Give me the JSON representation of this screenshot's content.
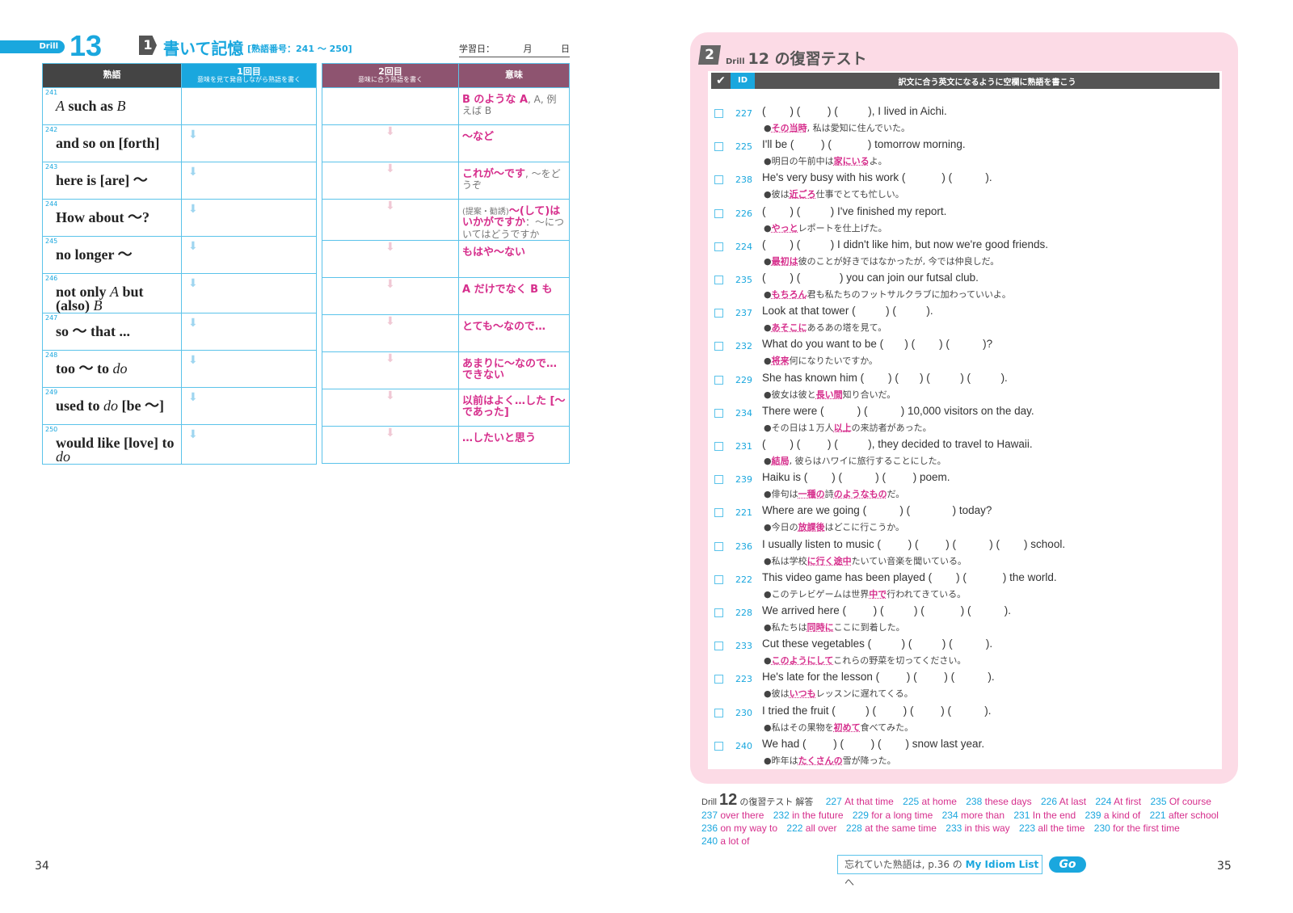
{
  "left": {
    "drill_label": "Drill",
    "drill_number": "13",
    "section_badge": "1",
    "section_title": "書いて記憶",
    "section_range": "[熟語番号：241 ～ 250]",
    "study_date": {
      "label": "学習日：",
      "month": "月",
      "day": "日"
    },
    "headers": {
      "idiom": "熟語",
      "first": "1回目",
      "first_sub": "意味を見て発音しながら熟語を書く",
      "second": "2回目",
      "second_sub": "意味に合う熟語を書く",
      "meaning": "意味"
    },
    "colors": {
      "blue": "#1aa7de",
      "purple": "#8e5470",
      "dark": "#444444",
      "pink": "#d62e8c"
    },
    "rows": [
      {
        "num": "241",
        "idiom": [
          {
            "t": "A",
            "i": true
          },
          {
            "t": " such as "
          },
          {
            "t": "B",
            "i": true
          }
        ],
        "meaning": [
          {
            "t": "B のような A",
            "em": true
          },
          {
            "t": ", A, 例えば B"
          }
        ]
      },
      {
        "num": "242",
        "idiom": [
          {
            "t": "and so on [forth]"
          }
        ],
        "meaning": [
          {
            "t": "～など",
            "em": true
          }
        ]
      },
      {
        "num": "243",
        "idiom": [
          {
            "t": "here is [are] ～"
          }
        ],
        "meaning": [
          {
            "t": "これが～です",
            "em": true
          },
          {
            "t": ", ～をどうぞ"
          }
        ]
      },
      {
        "num": "244",
        "idiom": [
          {
            "t": "How about ～?"
          }
        ],
        "meaning": [
          {
            "t": "(提案・勧誘)",
            "pre": true
          },
          {
            "t": "～(して)はいかがですか",
            "em": true
          },
          {
            "t": "：～についてはどうですか"
          }
        ]
      },
      {
        "num": "245",
        "idiom": [
          {
            "t": "no longer ～"
          }
        ],
        "meaning": [
          {
            "t": "もはや～ない",
            "em": true
          }
        ]
      },
      {
        "num": "246",
        "idiom": [
          {
            "t": "not only "
          },
          {
            "t": "A",
            "i": true
          },
          {
            "t": " but (also) "
          },
          {
            "t": "B",
            "i": true
          }
        ],
        "meaning": [
          {
            "t": "A だけでなく B も",
            "em": true
          }
        ]
      },
      {
        "num": "247",
        "idiom": [
          {
            "t": "so ～ that ..."
          }
        ],
        "meaning": [
          {
            "t": "とても～なので…",
            "em": true
          }
        ]
      },
      {
        "num": "248",
        "idiom": [
          {
            "t": "too ～ to "
          },
          {
            "t": "do",
            "i": true
          }
        ],
        "meaning": [
          {
            "t": "あまりに～なので…できない",
            "em": true
          }
        ]
      },
      {
        "num": "249",
        "idiom": [
          {
            "t": "used to "
          },
          {
            "t": "do",
            "i": true
          },
          {
            "t": " [be ～]"
          }
        ],
        "meaning": [
          {
            "t": "以前はよく…した [～であった]",
            "em": true
          }
        ]
      },
      {
        "num": "250",
        "idiom": [
          {
            "t": "would like [love] to "
          },
          {
            "t": "do",
            "i": true
          }
        ],
        "meaning": [
          {
            "t": "…したいと思う",
            "em": true
          }
        ]
      }
    ],
    "page_number": "34"
  },
  "right": {
    "section_badge": "2",
    "drill_label": "Drill",
    "title": "12 の復習テスト",
    "header": {
      "check": "✔",
      "id": "ID",
      "instruction": "訳文に合う英文になるように空欄に熟語を書こう"
    },
    "items": [
      {
        "id": "227",
        "en": "(        ) (         ) (          ), I lived in Aichi.",
        "ja": [
          {
            "t": "その当時",
            "em": true
          },
          {
            "t": ", 私は愛知に住んでいた。"
          }
        ]
      },
      {
        "id": "225",
        "en": "I'll be (         ) (            ) tomorrow morning.",
        "ja": [
          {
            "t": "明日の午前中は"
          },
          {
            "t": "家にいる",
            "em": true
          },
          {
            "t": "よ。"
          }
        ]
      },
      {
        "id": "238",
        "en": "He's very busy with his work (            ) (           ).",
        "ja": [
          {
            "t": "彼は"
          },
          {
            "t": "近ごろ",
            "em": true
          },
          {
            "t": "仕事でとても忙しい。"
          }
        ]
      },
      {
        "id": "226",
        "en": "(        ) (          ) I've finished my report.",
        "ja": [
          {
            "t": "やっと",
            "em": true
          },
          {
            "t": "レポートを仕上げた。"
          }
        ]
      },
      {
        "id": "224",
        "en": "(        ) (          ) I didn't like him, but now we're good friends.",
        "ja": [
          {
            "t": "最初は",
            "em": true
          },
          {
            "t": "彼のことが好きではなかったが, 今では仲良しだ。"
          }
        ]
      },
      {
        "id": "235",
        "en": "(        ) (             ) you can join our futsal club.",
        "ja": [
          {
            "t": "もちろん",
            "em": true
          },
          {
            "t": "君も私たちのフットサルクラブに加わっていいよ。"
          }
        ]
      },
      {
        "id": "237",
        "en": "Look at that tower (          ) (          ).",
        "ja": [
          {
            "t": "あそこに",
            "em": true
          },
          {
            "t": "あるあの塔を見て。"
          }
        ]
      },
      {
        "id": "232",
        "en": "What do you want to be (       ) (        ) (           )?",
        "ja": [
          {
            "t": "将来",
            "em": true
          },
          {
            "t": "何になりたいですか。"
          }
        ]
      },
      {
        "id": "229",
        "en": "She has known him (        ) (       ) (          ) (          ).",
        "ja": [
          {
            "t": "彼女は彼と"
          },
          {
            "t": "長い間",
            "em": true
          },
          {
            "t": "知り合いだ。"
          }
        ]
      },
      {
        "id": "234",
        "en": "There were (           ) (           ) 10,000 visitors on the day.",
        "ja": [
          {
            "t": "その日は１万人"
          },
          {
            "t": "以上",
            "em": true
          },
          {
            "t": "の来訪者があった。"
          }
        ]
      },
      {
        "id": "231",
        "en": "(        ) (         ) (          ), they decided to travel to Hawaii.",
        "ja": [
          {
            "t": "結局",
            "em": true
          },
          {
            "t": ", 彼らはハワイに旅行することにした。"
          }
        ]
      },
      {
        "id": "239",
        "en": "Haiku is (        ) (           ) (         ) poem.",
        "ja": [
          {
            "t": "俳句は"
          },
          {
            "t": "一種の",
            "em": true
          },
          {
            "t": "詩"
          },
          {
            "t": "のようなもの",
            "em": true
          },
          {
            "t": "だ。"
          }
        ]
      },
      {
        "id": "221",
        "en": "Where are we going (           ) (              ) today?",
        "ja": [
          {
            "t": "今日の"
          },
          {
            "t": "放課後",
            "em": true
          },
          {
            "t": "はどこに行こうか。"
          }
        ]
      },
      {
        "id": "236",
        "en": "I usually listen to music (         ) (         ) (           ) (        ) school.",
        "ja": [
          {
            "t": "私は学校"
          },
          {
            "t": "に行く途中",
            "em": true
          },
          {
            "t": "たいてい音楽を聞いている。"
          }
        ]
      },
      {
        "id": "222",
        "en": "This video game has been played (        ) (            ) the world.",
        "ja": [
          {
            "t": "このテレビゲームは世界"
          },
          {
            "t": "中で",
            "em": true
          },
          {
            "t": "行われてきている。"
          }
        ]
      },
      {
        "id": "228",
        "en": "We arrived here (         ) (          ) (            ) (           ).",
        "ja": [
          {
            "t": "私たちは"
          },
          {
            "t": "同時に",
            "em": true
          },
          {
            "t": "ここに到着した。"
          }
        ]
      },
      {
        "id": "233",
        "en": "Cut these vegetables (          ) (          ) (           ).",
        "ja": [
          {
            "t": "このようにして",
            "em": true
          },
          {
            "t": "これらの野菜を切ってください。"
          }
        ]
      },
      {
        "id": "223",
        "en": "He's late for the lesson (         ) (         ) (           ).",
        "ja": [
          {
            "t": "彼は"
          },
          {
            "t": "いつも",
            "em": true
          },
          {
            "t": "レッスンに遅れてくる。"
          }
        ]
      },
      {
        "id": "230",
        "en": "I tried the fruit (          ) (         ) (         ) (           ).",
        "ja": [
          {
            "t": "私はその果物を"
          },
          {
            "t": "初めて",
            "em": true
          },
          {
            "t": "食べてみた。"
          }
        ]
      },
      {
        "id": "240",
        "en": "We had (         ) (         ) (        ) snow last year.",
        "ja": [
          {
            "t": "昨年は"
          },
          {
            "t": "たくさんの",
            "em": true
          },
          {
            "t": "雪が降った。"
          }
        ]
      }
    ],
    "answers_head": {
      "drill": "Drill",
      "num": "12",
      "label": "の復習テスト 解答"
    },
    "answers": [
      {
        "n": "227",
        "p": "At that time"
      },
      {
        "n": "225",
        "p": "at home"
      },
      {
        "n": "238",
        "p": "these days"
      },
      {
        "n": "226",
        "p": "At last"
      },
      {
        "n": "224",
        "p": "At first"
      },
      {
        "n": "235",
        "p": "Of course"
      },
      {
        "n": "237",
        "p": "over there"
      },
      {
        "n": "232",
        "p": "in the future"
      },
      {
        "n": "229",
        "p": "for a long time"
      },
      {
        "n": "234",
        "p": "more than"
      },
      {
        "n": "231",
        "p": "In the end"
      },
      {
        "n": "239",
        "p": "a kind of"
      },
      {
        "n": "221",
        "p": "after school"
      },
      {
        "n": "236",
        "p": "on my way to"
      },
      {
        "n": "222",
        "p": "all over"
      },
      {
        "n": "228",
        "p": "at the same time"
      },
      {
        "n": "233",
        "p": "in this way"
      },
      {
        "n": "223",
        "p": "all the time"
      },
      {
        "n": "230",
        "p": "for the first time"
      },
      {
        "n": "240",
        "p": "a lot of"
      }
    ],
    "mylist": {
      "pre": "忘れていた熟語は, p.36 の ",
      "link": "My Idiom List",
      "post": " へ",
      "go": "Go"
    },
    "page_number": "35"
  }
}
